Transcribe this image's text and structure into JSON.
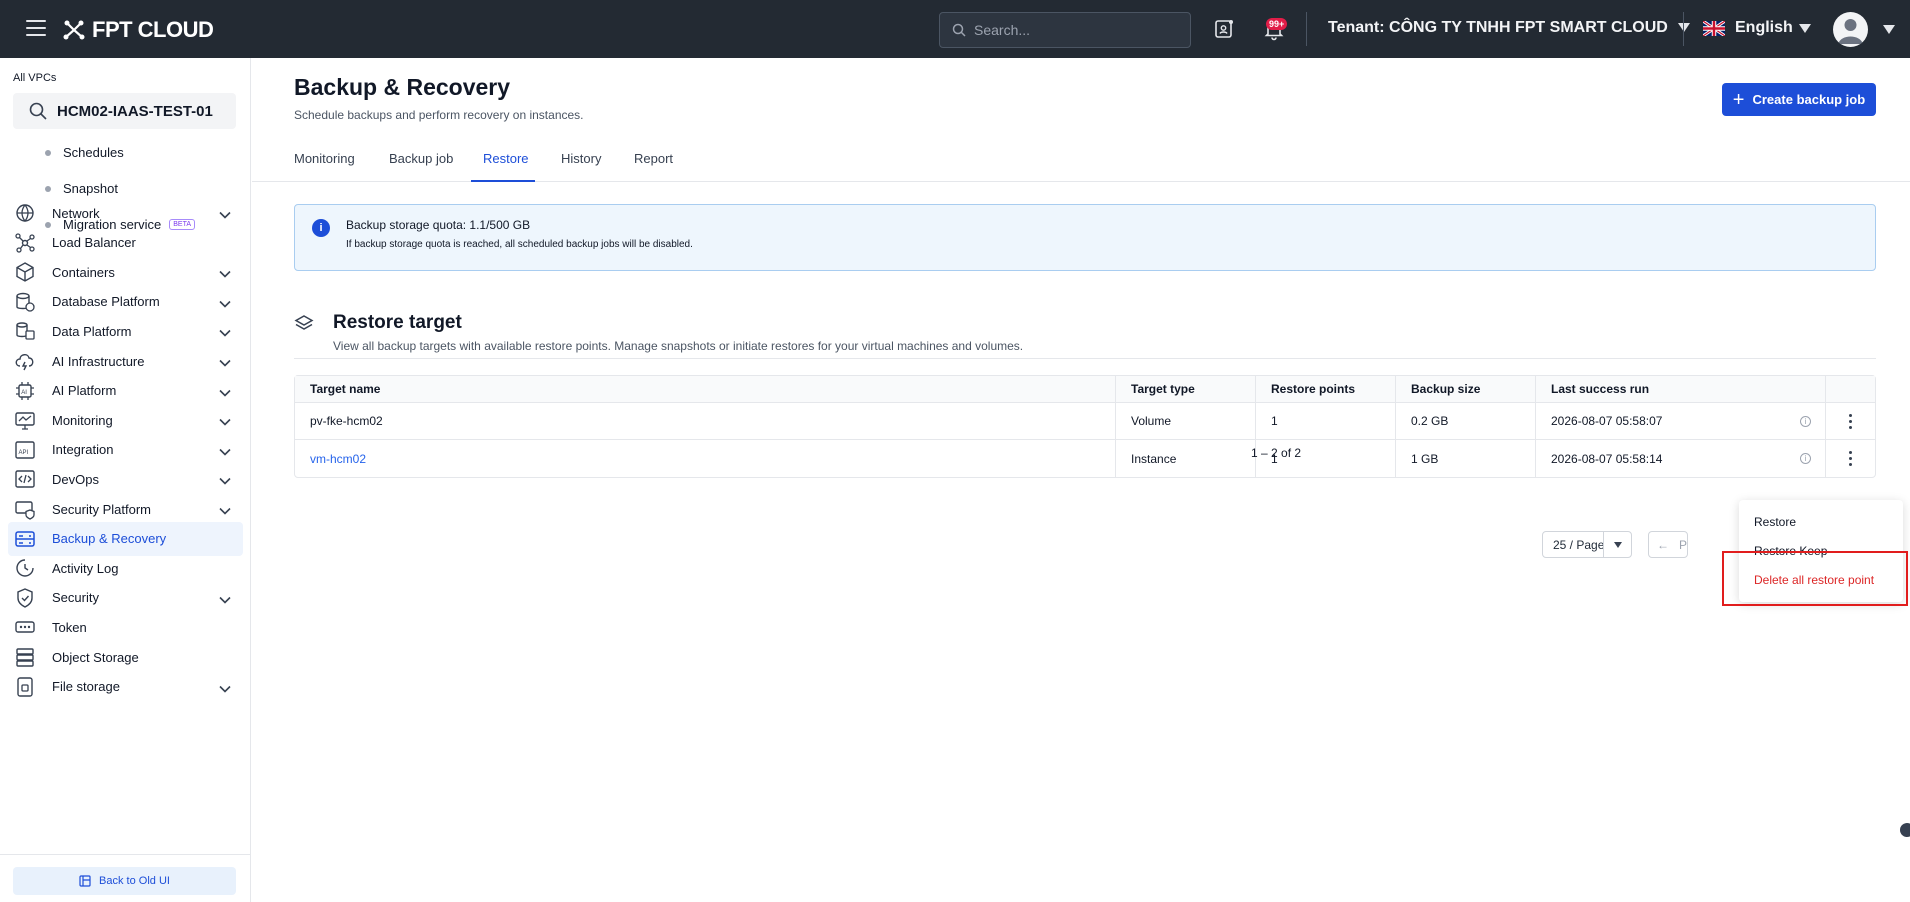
{
  "topbar": {
    "logo_text": "FPT CLOUD",
    "search_placeholder": "Search...",
    "notification_badge": "99+",
    "tenant_label": "Tenant:",
    "tenant_name": "CÔNG TY TNHH FPT SMART CLOUD",
    "language": "English"
  },
  "sidebar": {
    "all_vpcs_label": "All VPCs",
    "vpc_name": "HCM02-IAAS-TEST-01",
    "sub_items": [
      {
        "label": "Schedules"
      },
      {
        "label": "Snapshot"
      },
      {
        "label": "Migration service",
        "badge": "BETA"
      }
    ],
    "items": [
      {
        "label": "Network",
        "icon": "globe-icon",
        "expandable": true
      },
      {
        "label": "Load Balancer",
        "icon": "network-icon",
        "expandable": false
      },
      {
        "label": "Containers",
        "icon": "cube-icon",
        "expandable": true
      },
      {
        "label": "Database Platform",
        "icon": "database-icon",
        "expandable": true
      },
      {
        "label": "Data Platform",
        "icon": "data-platform-icon",
        "expandable": true
      },
      {
        "label": "AI Infrastructure",
        "icon": "ai-infra-icon",
        "expandable": true
      },
      {
        "label": "AI Platform",
        "icon": "chip-icon",
        "expandable": true
      },
      {
        "label": "Monitoring",
        "icon": "monitor-icon",
        "expandable": true
      },
      {
        "label": "Integration",
        "icon": "api-icon",
        "expandable": true
      },
      {
        "label": "DevOps",
        "icon": "code-icon",
        "expandable": true
      },
      {
        "label": "Security Platform",
        "icon": "security-platform-icon",
        "expandable": true
      },
      {
        "label": "Backup & Recovery",
        "icon": "backup-icon",
        "expandable": false,
        "active": true
      },
      {
        "label": "Activity Log",
        "icon": "clock-icon",
        "expandable": false
      },
      {
        "label": "Security",
        "icon": "shield-icon",
        "expandable": true
      },
      {
        "label": "Token",
        "icon": "token-icon",
        "expandable": false
      },
      {
        "label": "Object Storage",
        "icon": "storage-icon",
        "expandable": false
      },
      {
        "label": "File storage",
        "icon": "file-storage-icon",
        "expandable": true
      }
    ],
    "back_to_old_ui": "Back to Old UI"
  },
  "page": {
    "title": "Backup & Recovery",
    "subtitle": "Schedule backups and perform recovery on instances.",
    "create_button": "Create backup job",
    "tabs": [
      {
        "label": "Monitoring"
      },
      {
        "label": "Backup job"
      },
      {
        "label": "Restore",
        "active": true
      },
      {
        "label": "History"
      },
      {
        "label": "Report"
      }
    ]
  },
  "info_banner": {
    "title": "Backup storage quota: 1.1/500 GB",
    "text": "If backup storage quota is reached, all scheduled backup jobs will be disabled."
  },
  "section": {
    "title": "Restore target",
    "description": "View all backup targets with available restore points. Manage snapshots or initiate restores for your virtual machines and volumes."
  },
  "table": {
    "columns": [
      "Target name",
      "Target type",
      "Restore points",
      "Backup size",
      "Last success run"
    ],
    "rows": [
      {
        "name": "pv-fke-hcm02",
        "type": "Volume",
        "restore_points": "1",
        "size": "0.2 GB",
        "last_run": "2026-08-07 05:58:07",
        "link": false
      },
      {
        "name": "vm-hcm02",
        "type": "Instance",
        "restore_points": "1",
        "size": "1 GB",
        "last_run": "2026-08-07 05:58:14",
        "link": true
      }
    ]
  },
  "pagination": {
    "total": "1 – 2 of 2",
    "page_size": "25 / Page",
    "prev_label": "P"
  },
  "context_menu": {
    "items": [
      "Restore",
      "Restore Keep",
      "Delete all restore point"
    ]
  },
  "colors": {
    "accent": "#1d4ed8",
    "topbar": "#232a33",
    "danger": "#dc2626"
  }
}
